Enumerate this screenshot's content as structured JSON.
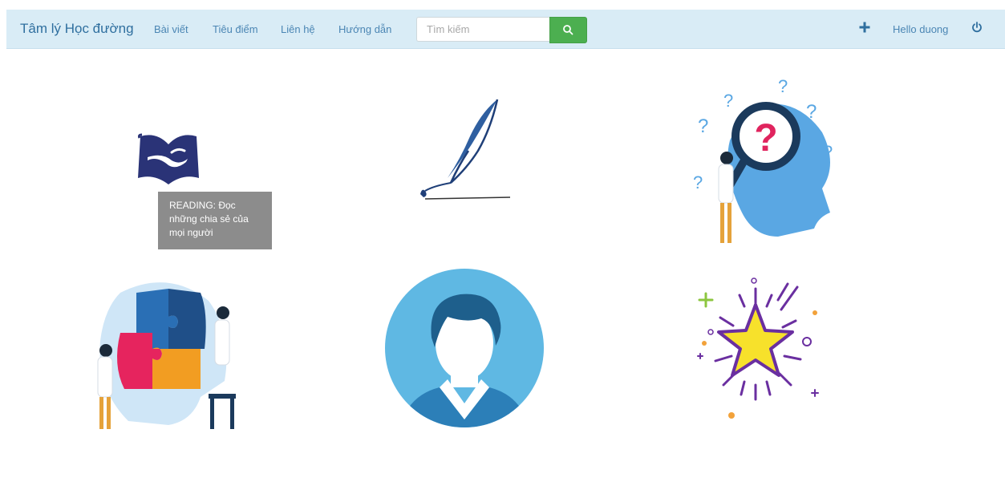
{
  "navbar": {
    "brand": "Tâm lý Học đường",
    "links": [
      "Bài viết",
      "Tiêu điểm",
      "Liên hệ",
      "Hướng dẫn"
    ],
    "search_placeholder": "Tìm kiếm",
    "greeting": "Hello duong",
    "icons": {
      "search": "search-icon",
      "add": "plus-icon",
      "logout": "power-icon"
    }
  },
  "tooltip": {
    "text": "READING: Đọc những chia sẻ của mọi người"
  },
  "tiles": [
    {
      "name": "reading-book-hand-icon"
    },
    {
      "name": "writing-quill-icon"
    },
    {
      "name": "question-head-icon"
    },
    {
      "name": "puzzle-head-icon"
    },
    {
      "name": "user-avatar-icon"
    },
    {
      "name": "star-icon"
    }
  ],
  "colors": {
    "navbar_bg": "#d9ecf6",
    "brand": "#2f6f9f",
    "link": "#4b86b4",
    "search_button": "#4caf50",
    "tooltip_bg": "#8c8c8c"
  }
}
